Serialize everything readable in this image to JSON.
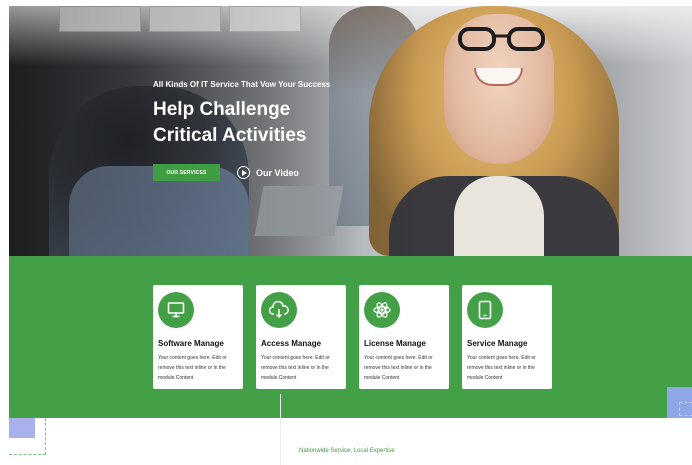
{
  "hero": {
    "eyebrow": "All Kinds Of IT Service That Vow Your Success",
    "title_line1": "Help Challenge",
    "title_line2": "Critical Activities",
    "services_button": "OUR SERVICES",
    "video_label": "Our Video",
    "play_icon": "play-circle-icon"
  },
  "services": [
    {
      "icon": "monitor-icon",
      "title": "Software Manage",
      "body": "Your content goes here. Edit or remove this text inline or in the module Content"
    },
    {
      "icon": "cloud-download-icon",
      "title": "Access Manage",
      "body": "Your content goes here. Edit or remove this text inline or in the module Content"
    },
    {
      "icon": "atom-icon",
      "title": "License Manage",
      "body": "Your content goes here. Edit or remove this text inline or in the module Content"
    },
    {
      "icon": "tablet-icon",
      "title": "Service Manage",
      "body": "Your content goes here. Edit or remove this text inline or in the module Content"
    }
  ],
  "footer": {
    "tagline": "Nationwide Service, Local Expertise"
  },
  "colors": {
    "brand_green": "#43a047",
    "accent_lavender": "#8ea7e8",
    "white": "#ffffff"
  }
}
